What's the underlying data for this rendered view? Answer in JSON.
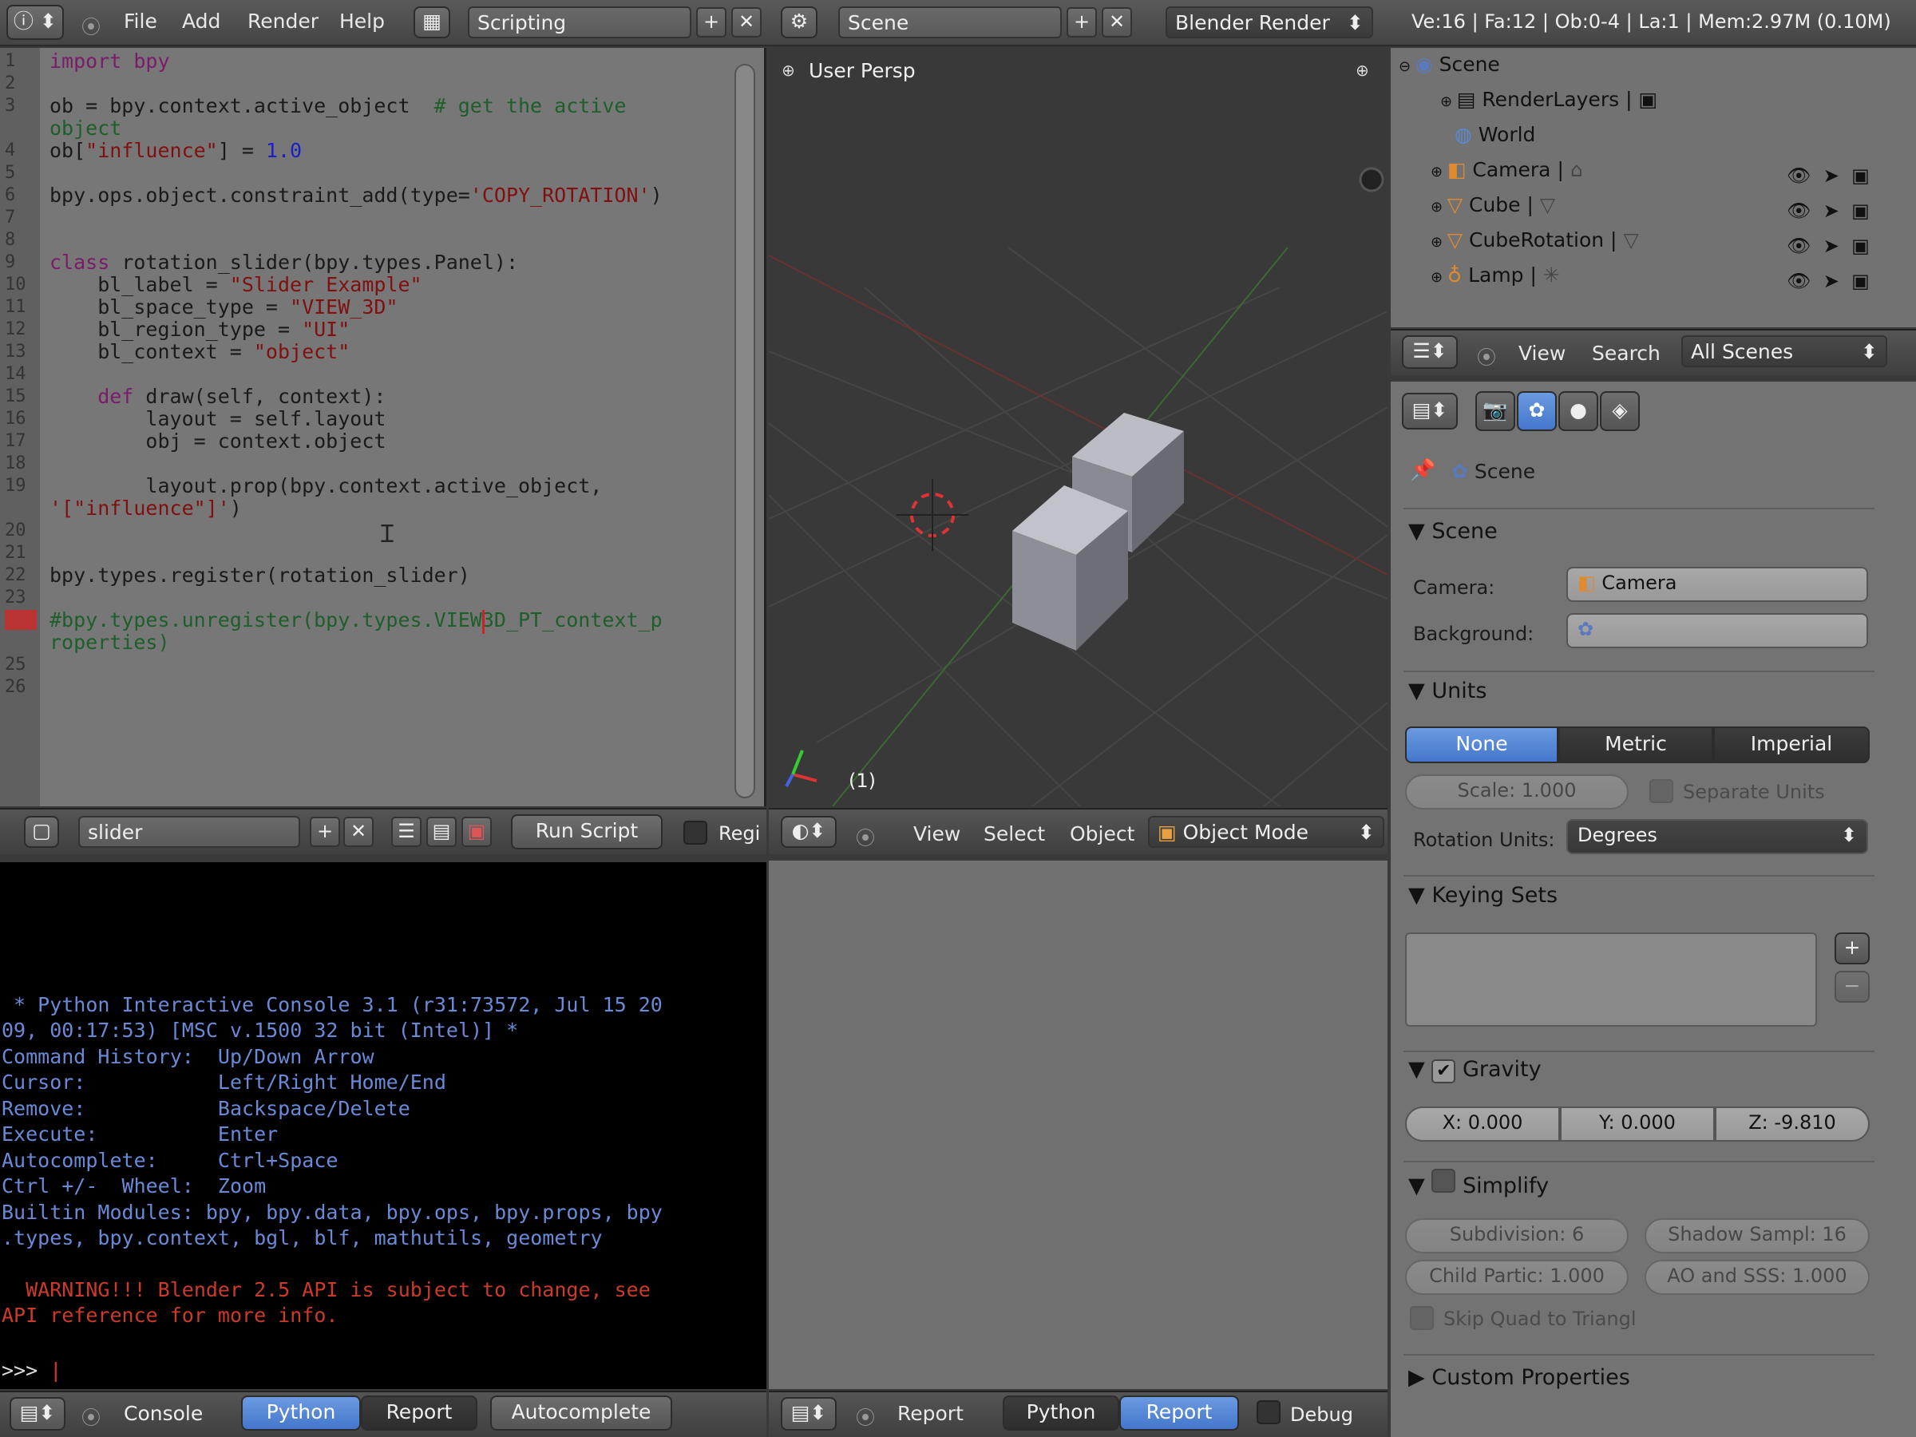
{
  "topbar": {
    "menu": [
      "File",
      "Add",
      "Render",
      "Help"
    ],
    "screen_layout": "Scripting",
    "scene": "Scene",
    "render_engine": "Blender Render",
    "stats": "Ve:16 | Fa:12 | Ob:0-4 | La:1 | Mem:2.97M (0.10M)"
  },
  "editor": {
    "line_numbers": [
      "1",
      "2",
      "3",
      "4",
      "5",
      "6",
      "7",
      "8",
      "9",
      "10",
      "11",
      "12",
      "13",
      "14",
      "15",
      "16",
      "17",
      "18",
      "19",
      "20",
      "21",
      "22",
      "23",
      "24",
      "25",
      "26"
    ],
    "lines": [
      {
        "t": "import bpy",
        "c": "kw"
      },
      {
        "t": "ob = bpy.context.active_object  ",
        "c": "",
        "t2": "# get the active",
        "c2": "cm"
      },
      {
        "t": "object",
        "c": "cm"
      },
      {
        "t": "ob[",
        "c": "",
        "t2": "\"influence\"",
        "c2": "str",
        "t3": "] = ",
        "t4": "1.0"
      },
      {
        "t": "bpy.ops.object.constraint_add(type=",
        "c": "",
        "t2": "'COPY_ROTATION'",
        "c2": "str",
        "t3": ")"
      },
      {
        "t": "class",
        "c": "kw",
        "t2": " rotation_slider(bpy.types.Panel):",
        "c2": ""
      },
      {
        "t": "    bl_label = ",
        "c": "",
        "t2": "\"Slider Example\"",
        "c2": "str"
      },
      {
        "t": "    bl_space_type = ",
        "c": "",
        "t2": "\"VIEW_3D\"",
        "c2": "str"
      },
      {
        "t": "    bl_region_type = ",
        "c": "",
        "t2": "\"UI\"",
        "c2": "str"
      },
      {
        "t": "    bl_context = ",
        "c": "",
        "t2": "\"object\"",
        "c2": "str"
      },
      {
        "t": "    def",
        "c": "kw",
        "t2": " draw(self, context):",
        "c2": ""
      },
      {
        "t": "        layout = self.layout",
        "c": ""
      },
      {
        "t": "        obj = context.object",
        "c": ""
      },
      {
        "t": "        layout.prop(bpy.context.active_object,",
        "c": ""
      },
      {
        "t": "'[\"influence\"]'",
        "c": "str",
        "t2": ")",
        "c2": ""
      },
      {
        "t": "bpy.types.register(rotation_slider)",
        "c": ""
      },
      {
        "t": "#bpy.types.unregister(bpy.types.VIEW3D_PT_context_p",
        "c": "cm"
      },
      {
        "t": "roperties)",
        "c": "cm"
      }
    ],
    "footer": {
      "text_name": "slider",
      "run_script": "Run Script",
      "register": "Regi"
    }
  },
  "console": {
    "lines": [
      " * Python Interactive Console 3.1 (r31:73572, Jul 15 20",
      "09, 00:17:53) [MSC v.1500 32 bit (Intel)] *",
      "Command History:  Up/Down Arrow",
      "Cursor:           Left/Right Home/End",
      "Remove:           Backspace/Delete",
      "Execute:          Enter",
      "Autocomplete:     Ctrl+Space",
      "Ctrl +/-  Wheel:  Zoom",
      "Builtin Modules: bpy, bpy.data, bpy.ops, bpy.props, bpy",
      ".types, bpy.context, bgl, blf, mathutils, geometry"
    ],
    "warning": [
      "  WARNING!!! Blender 2.5 API is subject to change, see",
      "API reference for more info."
    ],
    "prompt": ">>> ",
    "footer": {
      "label": "Console",
      "python": "Python",
      "report": "Report",
      "autocomplete": "Autocomplete"
    }
  },
  "viewport": {
    "label": "User Persp",
    "frame": "(1)",
    "footer": {
      "view": "View",
      "select": "Select",
      "object": "Object",
      "mode": "Object Mode"
    }
  },
  "info_footer": {
    "report_label": "Report",
    "python": "Python",
    "report": "Report",
    "debug": "Debug"
  },
  "outliner": {
    "items": [
      {
        "label": "Scene",
        "icon": "scene-icon"
      },
      {
        "label": "RenderLayers",
        "icon": "render-layers-icon"
      },
      {
        "label": "World",
        "icon": "world-icon"
      },
      {
        "label": "Camera",
        "icon": "camera-icon"
      },
      {
        "label": "Cube",
        "icon": "mesh-icon"
      },
      {
        "label": "CubeRotation",
        "icon": "mesh-icon"
      },
      {
        "label": "Lamp",
        "icon": "lamp-icon"
      }
    ],
    "footer": {
      "view": "View",
      "search": "Search",
      "filter": "All Scenes"
    }
  },
  "properties": {
    "context": "Scene",
    "scene_section": "Scene",
    "camera_label": "Camera:",
    "camera_value": "Camera",
    "background_label": "Background:",
    "units_section": "Units",
    "unit_options": [
      "None",
      "Metric",
      "Imperial"
    ],
    "unit_selected": "None",
    "scale": "Scale: 1.000",
    "separate_units": "Separate Units",
    "rotation_units_label": "Rotation Units:",
    "rotation_units_value": "Degrees",
    "keying_sets_section": "Keying Sets",
    "gravity_section": "Gravity",
    "gravity": [
      "X: 0.000",
      "Y: 0.000",
      "Z: -9.810"
    ],
    "simplify_section": "Simplify",
    "subdivision": "Subdivision: 6",
    "shadow_samples": "Shadow Sampl: 16",
    "child_particles": "Child Partic: 1.000",
    "ao_sss": "AO and SSS: 1.000",
    "skip_quad": "Skip Quad to Triangl",
    "custom_properties": "Custom Properties"
  },
  "colors": {
    "accent": "#4477cc",
    "console_text": "#6a8ad8",
    "warning": "#cc3a2a"
  }
}
